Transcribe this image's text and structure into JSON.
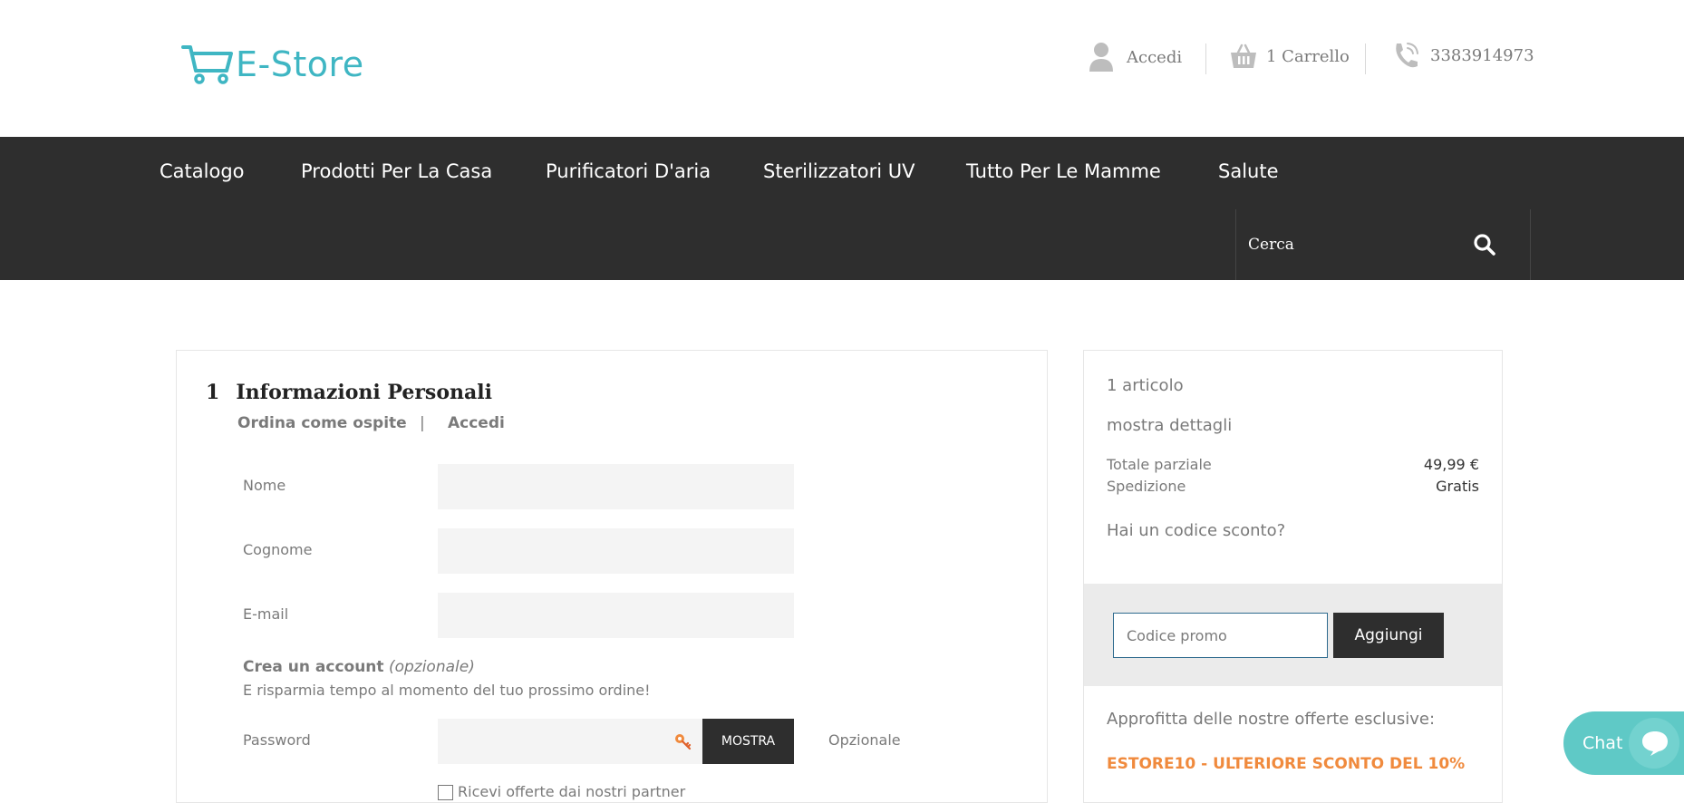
{
  "header": {
    "logo_text": "E-Store",
    "login_label": "Accedi",
    "cart_label": "1 Carrello",
    "phone": "3383914973",
    "brand_color": "#3fb6c3",
    "icons": {
      "login": "user-icon",
      "cart": "basket-icon",
      "phone": "phone-icon"
    }
  },
  "nav": {
    "items": [
      {
        "label": "Catalogo"
      },
      {
        "label": "Prodotti Per La Casa"
      },
      {
        "label": "Purificatori D'aria"
      },
      {
        "label": "Sterilizzatori UV"
      },
      {
        "label": "Tutto Per Le Mamme"
      },
      {
        "label": "Salute"
      }
    ],
    "search_placeholder": "Cerca",
    "background_color": "#2e2e2e"
  },
  "checkout": {
    "step_number": "1",
    "step_title": "Informazioni Personali",
    "tabs": {
      "guest": "Ordina come ospite",
      "separator": "|",
      "login": "Accedi"
    },
    "fields": {
      "first_name_label": "Nome",
      "last_name_label": "Cognome",
      "email_label": "E-mail",
      "password_label": "Password",
      "first_name_value": "",
      "last_name_value": "",
      "email_value": "",
      "password_value": ""
    },
    "create_account": {
      "title": "Crea un account",
      "optional": "(opzionale)",
      "subtitle": "E risparmia tempo al momento del tuo prossimo ordine!"
    },
    "show_password_button": "MOSTRA",
    "password_hint": "Opzionale",
    "offers_checkbox_label": "Ricevi offerte dai nostri partner"
  },
  "summary": {
    "item_count": "1 articolo",
    "details_link": "mostra dettagli",
    "subtotal_label": "Totale parziale",
    "subtotal_value": "49,99 €",
    "shipping_label": "Spedizione",
    "shipping_value": "Gratis",
    "discount_question": "Hai un codice sconto?",
    "promo_placeholder": "Codice promo",
    "promo_value": "",
    "add_button": "Aggiungi",
    "offers_intro": "Approfitta delle nostre offerte esclusive:",
    "offer_code": "ESTORE10 - ULTERIORE SCONTO DEL 10%",
    "offer_color": "#f08a3d"
  },
  "chat": {
    "label": "Chat",
    "color": "#5fc9c6"
  }
}
